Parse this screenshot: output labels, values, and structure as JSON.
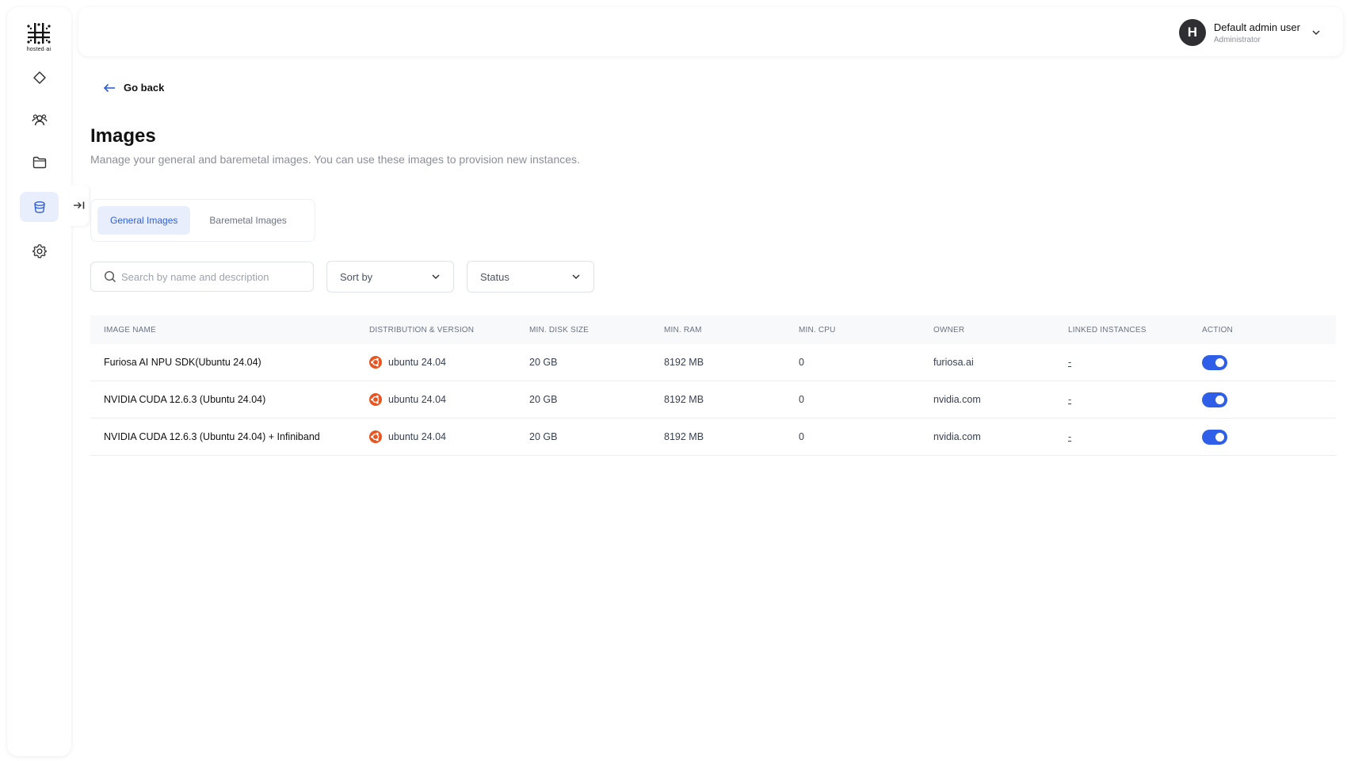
{
  "sidebar": {
    "logo_text": "hosted·ai",
    "items": [
      {
        "name": "dashboard",
        "icon": "diamond-icon"
      },
      {
        "name": "teams",
        "icon": "users-icon"
      },
      {
        "name": "projects",
        "icon": "folder-icon"
      },
      {
        "name": "images",
        "icon": "stack-icon",
        "active": true
      },
      {
        "name": "settings",
        "icon": "gear-icon"
      }
    ],
    "collapse_icon": "collapse-arrow-icon"
  },
  "header": {
    "user": {
      "initial": "H",
      "name": "Default admin user",
      "role": "Administrator"
    }
  },
  "nav": {
    "go_back": "Go back"
  },
  "page": {
    "title": "Images",
    "description": "Manage your general and baremetal images. You can use these images to provision new instances."
  },
  "tabs": [
    {
      "label": "General Images",
      "active": true
    },
    {
      "label": "Baremetal Images",
      "active": false
    }
  ],
  "filters": {
    "search_placeholder": "Search by name and description",
    "sort_label": "Sort by",
    "status_label": "Status"
  },
  "table": {
    "headers": [
      "IMAGE NAME",
      "DISTRIBUTION & VERSION",
      "MIN. DISK SIZE",
      "MIN. RAM",
      "MIN. CPU",
      "OWNER",
      "LINKED INSTANCES",
      "ACTION"
    ],
    "rows": [
      {
        "name": "Furiosa AI NPU SDK(Ubuntu 24.04)",
        "distro": "ubuntu 24.04",
        "disk": "20 GB",
        "ram": "8192 MB",
        "cpu": "0",
        "owner": "furiosa.ai",
        "linked": "-",
        "enabled": true
      },
      {
        "name": "NVIDIA CUDA 12.6.3 (Ubuntu 24.04)",
        "distro": "ubuntu 24.04",
        "disk": "20 GB",
        "ram": "8192 MB",
        "cpu": "0",
        "owner": "nvidia.com",
        "linked": "-",
        "enabled": true
      },
      {
        "name": "NVIDIA CUDA 12.6.3 (Ubuntu 24.04) + Infiniband",
        "distro": "ubuntu 24.04",
        "disk": "20 GB",
        "ram": "8192 MB",
        "cpu": "0",
        "owner": "nvidia.com",
        "linked": "-",
        "enabled": true
      }
    ]
  },
  "colors": {
    "accent": "#2f5fe8",
    "active_bg": "#e9eefc",
    "ubuntu": "#e95420"
  }
}
